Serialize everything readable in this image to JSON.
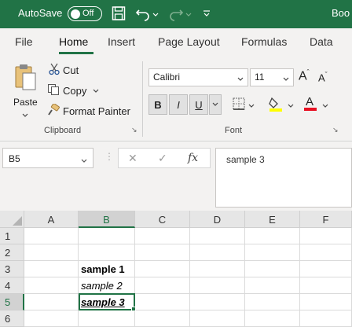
{
  "titlebar": {
    "autosave_label": "AutoSave",
    "autosave_state": "Off",
    "book_title": "Boo",
    "bg_color": "#217346"
  },
  "tabs": [
    {
      "label": "File",
      "active": false
    },
    {
      "label": "Home",
      "active": true
    },
    {
      "label": "Insert",
      "active": false
    },
    {
      "label": "Page Layout",
      "active": false
    },
    {
      "label": "Formulas",
      "active": false
    },
    {
      "label": "Data",
      "active": false
    }
  ],
  "clipboard": {
    "paste_label": "Paste",
    "cut_label": "Cut",
    "copy_label": "Copy",
    "format_painter_label": "Format Painter",
    "group_label": "Clipboard"
  },
  "font": {
    "font_name": "Calibri",
    "font_size": "11",
    "bold_label": "B",
    "italic_label": "I",
    "underline_label": "U",
    "group_label": "Font",
    "highlight_color": "#ffff00",
    "font_color": "#e81123"
  },
  "formula_bar": {
    "name_box": "B5",
    "fx_label": "fx",
    "formula_value": "sample 3"
  },
  "grid": {
    "columns": [
      "A",
      "B",
      "C",
      "D",
      "E",
      "F"
    ],
    "rows": [
      "1",
      "2",
      "3",
      "4",
      "5",
      "6"
    ],
    "selected_column": "B",
    "selected_row": "5",
    "cells": {
      "B3": "sample 1",
      "B4": "sample 2",
      "B5": "sample 3"
    }
  }
}
